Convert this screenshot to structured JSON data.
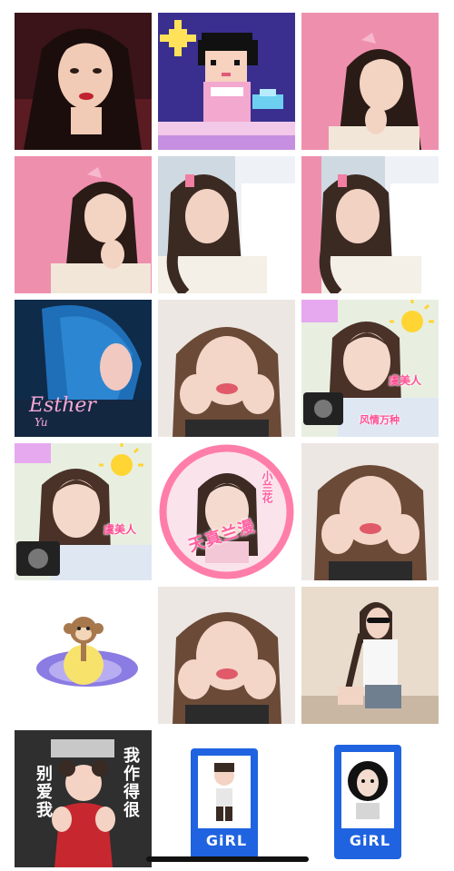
{
  "tiles": [
    {
      "name": "sticker-woman-red-lips",
      "kind": "photo"
    },
    {
      "name": "sticker-pixel-girl",
      "kind": "pixel-art"
    },
    {
      "name": "sticker-woman-pink-praying",
      "kind": "photo"
    },
    {
      "name": "sticker-woman-pink-praying-2",
      "kind": "photo"
    },
    {
      "name": "sticker-girl-braid-crying",
      "kind": "photo"
    },
    {
      "name": "sticker-girl-braid-crying-pink",
      "kind": "photo"
    },
    {
      "name": "sticker-esther-blue-hair",
      "kind": "photo",
      "title": "Esther",
      "subtitle": "Yu"
    },
    {
      "name": "sticker-girl-hands-cheeks",
      "kind": "photo"
    },
    {
      "name": "sticker-girl-camera-sun",
      "kind": "photo",
      "label1": "虞美人",
      "label2": "风情万种"
    },
    {
      "name": "sticker-girl-camera-sun-2",
      "kind": "photo",
      "label1": "虞美人"
    },
    {
      "name": "sticker-round-badge",
      "kind": "badge",
      "label_big": "天真兰漫",
      "label_small": "小兰花"
    },
    {
      "name": "sticker-girl-hands-cheeks-2",
      "kind": "photo"
    },
    {
      "name": "sticker-monkey-banana",
      "kind": "illustration"
    },
    {
      "name": "sticker-girl-hands-cheeks-3",
      "kind": "photo"
    },
    {
      "name": "sticker-girl-sunglasses-braids",
      "kind": "photo"
    },
    {
      "name": "sticker-baby-text",
      "kind": "photo",
      "left_text": "别爱我",
      "right_text": "我作得很"
    },
    {
      "name": "sticker-girl-card-doll",
      "kind": "card",
      "card_text": "GiRL"
    },
    {
      "name": "sticker-girl-card-curly",
      "kind": "card",
      "card_text": "GiRL"
    }
  ],
  "colors": {
    "pink_bg": "#ef8fae",
    "badge_pink": "#ff5fa0",
    "card_blue": "#1f63e0",
    "pixel_bg": "#3a2f8f"
  }
}
